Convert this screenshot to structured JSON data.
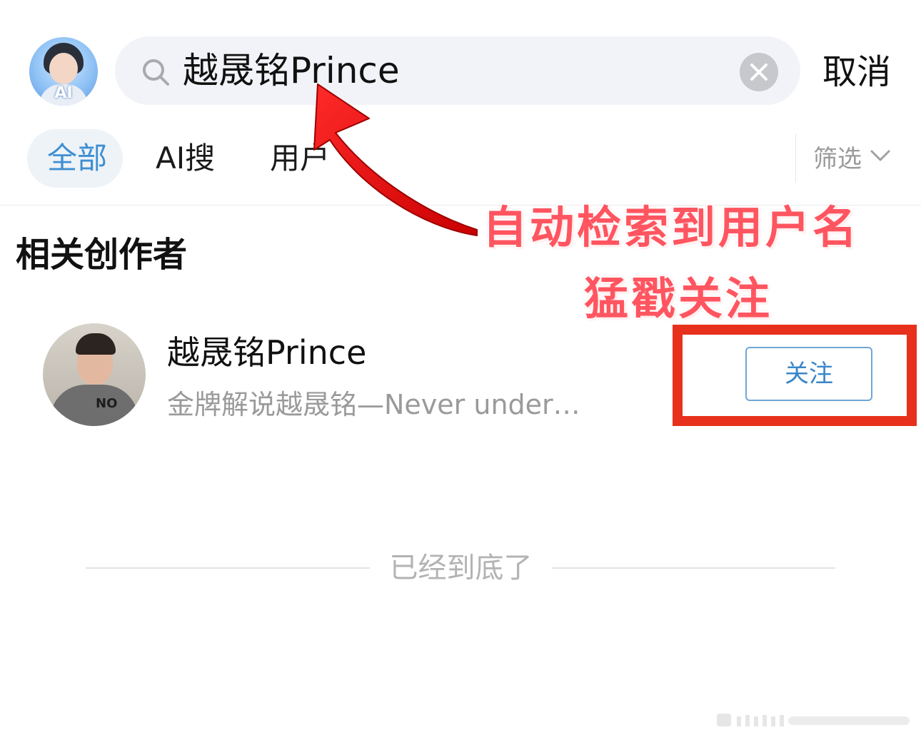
{
  "header": {
    "ai_avatar_label": "AI",
    "search_query": "越晟铭Prince",
    "cancel_label": "取消"
  },
  "tabs": [
    {
      "label": "全部",
      "active": true
    },
    {
      "label": "AI搜",
      "active": false
    },
    {
      "label": "用户",
      "active": false
    }
  ],
  "filter_label": "筛选",
  "section": {
    "title": "相关创作者",
    "users": [
      {
        "name": "越晟铭Prince",
        "description": "金牌解说越晟铭—Never under…",
        "follow_label": "关注",
        "avatar_shirt_text": "NO"
      }
    ]
  },
  "end_text": "已经到底了",
  "annotation": {
    "line1": "自动检索到用户名",
    "line2": "猛戳关注"
  },
  "colors": {
    "accent_blue": "#3f8fd2",
    "annotation_red": "#e7311c",
    "search_bg": "#f2f3f8"
  }
}
